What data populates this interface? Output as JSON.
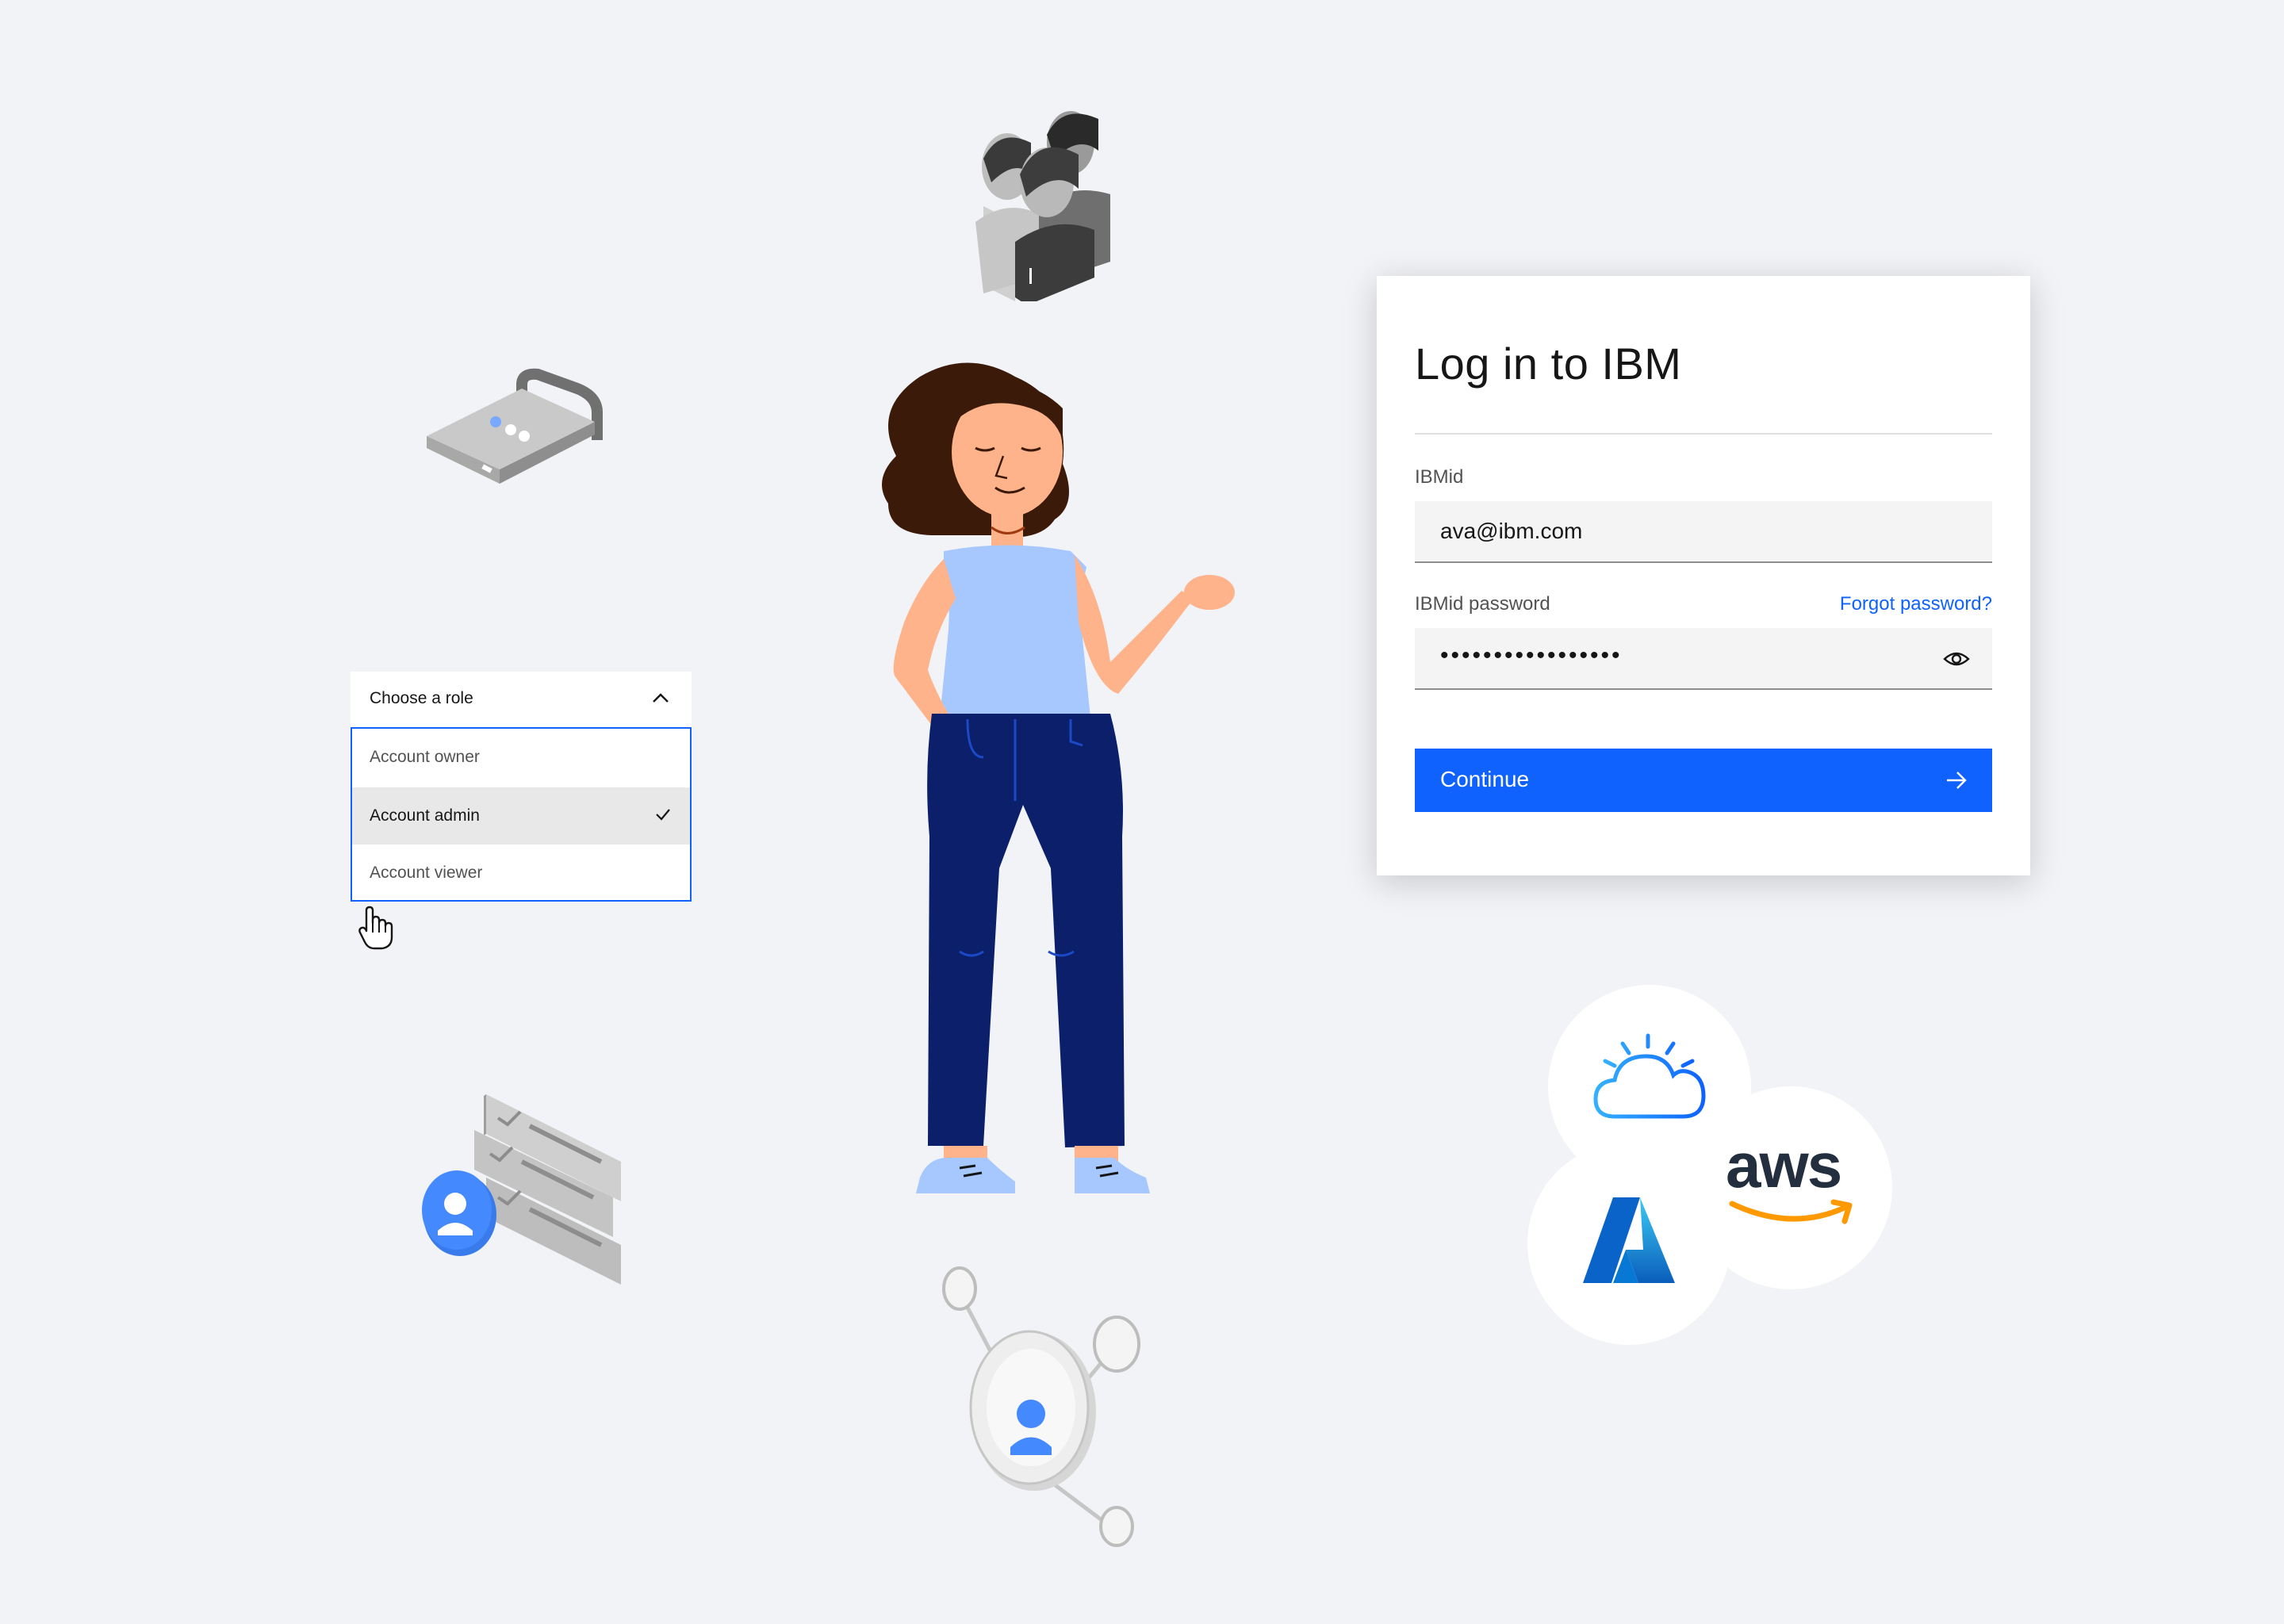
{
  "login": {
    "title": "Log in to IBM",
    "ibmid_label": "IBMid",
    "ibmid_value": "ava@ibm.com",
    "password_label": "IBMid password",
    "password_value": "•••••••••••••••••",
    "forgot_label": "Forgot password?",
    "continue_label": "Continue"
  },
  "role_dropdown": {
    "label": "Choose a role",
    "options": [
      "Account owner",
      "Account admin",
      "Account viewer"
    ],
    "selected": "Account admin"
  },
  "providers": {
    "aws_label": "aws"
  },
  "colors": {
    "accent": "#0f62fe",
    "background": "#f2f3f7",
    "pants": "#0b1f6b",
    "top": "#a6c8ff"
  },
  "icons": [
    "users-icon",
    "lock-icon",
    "checklist-user-icon",
    "network-user-icon",
    "ibm-cloud-icon",
    "azure-icon",
    "aws-icon",
    "hand-cursor-icon",
    "eye-icon",
    "arrow-right-icon",
    "chevron-up-icon",
    "checkmark-icon"
  ]
}
